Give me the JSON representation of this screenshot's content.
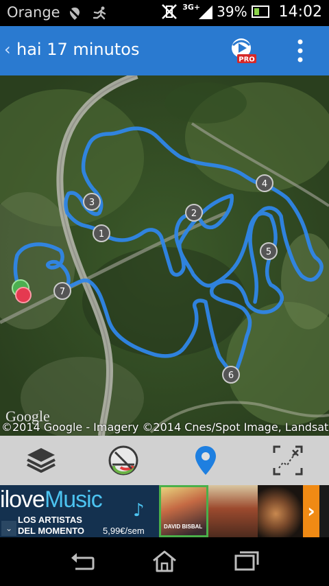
{
  "status_bar": {
    "carrier": "Orange",
    "network": "3G+",
    "battery_pct": "39%",
    "battery_level": 0.39,
    "time": "14:02",
    "icons_left": [
      "muted-location-icon",
      "running-icon"
    ],
    "icons_right": [
      "vibrate-off-icon",
      "signal-icon",
      "battery-icon"
    ]
  },
  "app_bar": {
    "title": "hai 17 minutos",
    "pro_badge": "PRO",
    "color": "#2a7ad0"
  },
  "map": {
    "google_logo": "Google",
    "attribution": "©2014 Google - Imagery ©2014 Cnes/Spot Image, Landsat, IC",
    "route_color": "#2f86e8",
    "markers": [
      "1",
      "2",
      "3",
      "4",
      "5",
      "6",
      "7"
    ],
    "start_color": "#4caf50",
    "end_color": "#e53950"
  },
  "toolbar": {
    "items": [
      "layers-icon",
      "speed-gauge-icon",
      "location-pin-icon",
      "route-crop-icon"
    ]
  },
  "ad": {
    "title_i": "i",
    "title_love": "love",
    "title_music": "Music",
    "line1": "LOS ARTISTAS",
    "line2": "DEL MOMENTO",
    "price": "5,99€/sem",
    "album1_label": "DAVID BISBAL"
  },
  "nav": {
    "items": [
      "back-icon",
      "home-icon",
      "recents-icon"
    ]
  }
}
